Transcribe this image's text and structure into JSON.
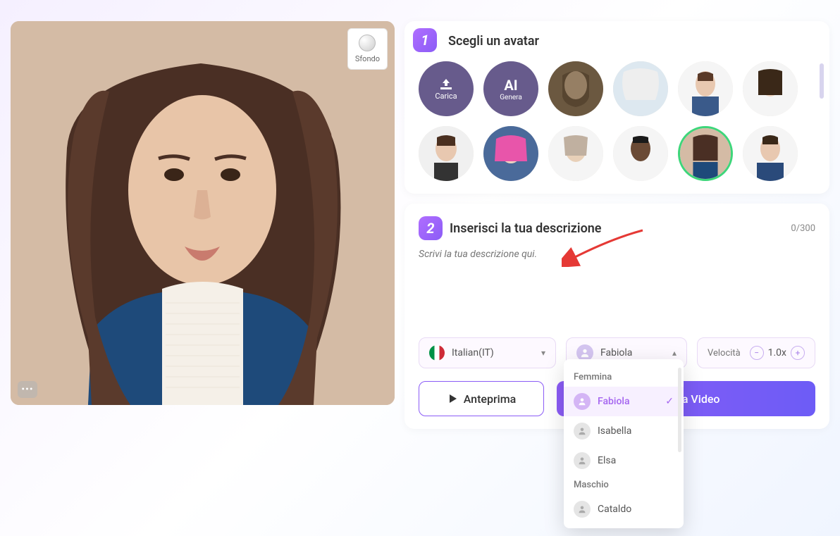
{
  "preview": {
    "sfondo_label": "Sfondo"
  },
  "step1": {
    "number": "1",
    "title": "Scegli un avatar",
    "upload_label": "Carica",
    "ai_label": "AI",
    "ai_sublabel": "Genera"
  },
  "step2": {
    "number": "2",
    "title": "Inserisci la tua descrizione",
    "counter": "0/300",
    "placeholder": "Scrivi la tua descrizione qui."
  },
  "controls": {
    "language": "Italian(IT)",
    "voice": "Fabiola",
    "speed_label": "Velocità",
    "speed_value": "1.0x"
  },
  "actions": {
    "preview": "Anteprima",
    "generate": "Genera Video"
  },
  "dropdown": {
    "group_female": "Femmina",
    "group_male": "Maschio",
    "options": {
      "fabiola": "Fabiola",
      "isabella": "Isabella",
      "elsa": "Elsa",
      "cataldo": "Cataldo"
    }
  }
}
